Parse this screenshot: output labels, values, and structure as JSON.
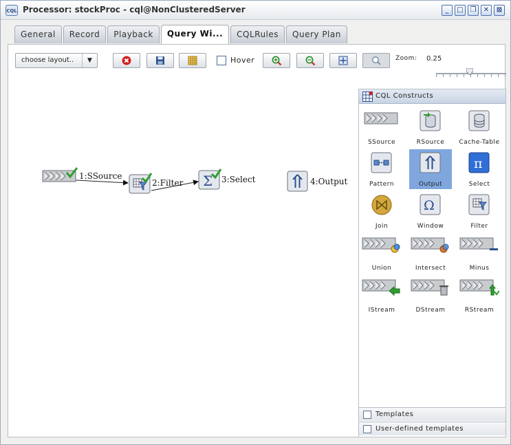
{
  "window": {
    "app_icon_text": "CQL",
    "title": "Processor: stockProc - cql@NonClusteredServer",
    "controls": [
      "minimize",
      "maximize",
      "restore",
      "close",
      "close-all"
    ]
  },
  "tabs": [
    "General",
    "Record",
    "Playback",
    "Query Wi...",
    "CQLRules",
    "Query Plan"
  ],
  "active_tab": "Query Wi...",
  "toolbar": {
    "layout_select": "choose layout..",
    "hover_label": "Hover",
    "hover_checked": false,
    "zoom_label": "Zoom:",
    "zoom_value": "0.25"
  },
  "canvas": {
    "nodes": [
      {
        "id": "ssource",
        "label": "1:SSource",
        "icon": "ssource-icon",
        "validated": true
      },
      {
        "id": "filter",
        "label": "2:Filter",
        "icon": "filter-icon",
        "validated": true
      },
      {
        "id": "select",
        "label": "3:Select",
        "icon": "select-icon",
        "validated": true
      },
      {
        "id": "output",
        "label": "4:Output",
        "icon": "output-icon",
        "validated": false
      }
    ],
    "edges": [
      {
        "from": "ssource",
        "to": "filter"
      },
      {
        "from": "filter",
        "to": "select"
      }
    ]
  },
  "palette": {
    "title": "CQL Constructs",
    "items": [
      {
        "label": "SSource",
        "icon": "ssource-icon"
      },
      {
        "label": "RSource",
        "icon": "rsource-icon"
      },
      {
        "label": "Cache-Table",
        "icon": "cache-table-icon"
      },
      {
        "label": "Pattern",
        "icon": "pattern-icon"
      },
      {
        "label": "Output",
        "icon": "output-icon",
        "selected": true
      },
      {
        "label": "Select",
        "icon": "select-icon"
      },
      {
        "label": "Join",
        "icon": "join-icon"
      },
      {
        "label": "Window",
        "icon": "window-icon"
      },
      {
        "label": "Filter",
        "icon": "filter-icon"
      },
      {
        "label": "Union",
        "icon": "union-icon"
      },
      {
        "label": "Intersect",
        "icon": "intersect-icon"
      },
      {
        "label": "Minus",
        "icon": "minus-icon"
      },
      {
        "label": "IStream",
        "icon": "istream-icon"
      },
      {
        "label": "DStream",
        "icon": "dstream-icon"
      },
      {
        "label": "RStream",
        "icon": "rstream-icon"
      }
    ],
    "sections": [
      "Templates",
      "User-defined templates"
    ]
  },
  "colors": {
    "selection": "#7fa7de",
    "validated_check": "#2e9e2e",
    "delete_red": "#d42020",
    "zoom_green": "#2f8f2f"
  }
}
